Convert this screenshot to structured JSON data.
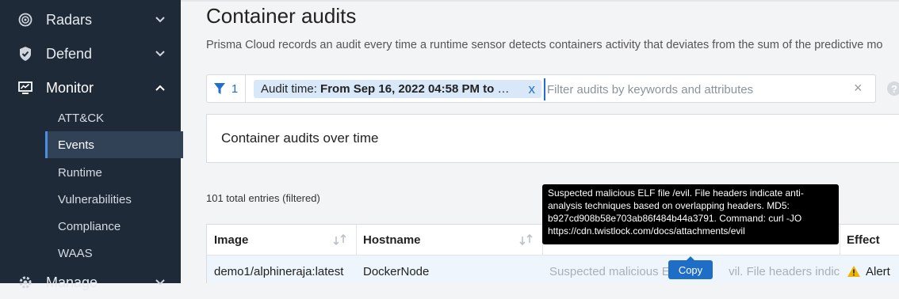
{
  "sidebar": {
    "items": [
      {
        "label": "Radars",
        "icon": "radar-icon",
        "expanded": false
      },
      {
        "label": "Defend",
        "icon": "shield-icon",
        "expanded": false
      },
      {
        "label": "Monitor",
        "icon": "monitor-icon",
        "expanded": true
      },
      {
        "label": "Manage",
        "icon": "gear-icon",
        "expanded": false
      }
    ],
    "sub_items": [
      "ATT&CK",
      "Events",
      "Runtime",
      "Vulnerabilities",
      "Compliance",
      "WAAS"
    ],
    "active_sub": "Events"
  },
  "page": {
    "title": "Container audits",
    "description": "Prisma Cloud records an audit every time a runtime sensor detects containers activity that deviates from the sum of the predictive mo"
  },
  "filter": {
    "count": "1",
    "chip_key": "Audit time:",
    "chip_value": "From Sep 16, 2022 04:58 PM to De...",
    "chip_remove": "x",
    "placeholder": "Filter audits by keywords and attributes",
    "clear": "×",
    "help": "?"
  },
  "chart": {
    "title": "Container audits over time"
  },
  "table": {
    "total": "101 total entries (filtered)",
    "columns": [
      "Image",
      "Hostname",
      "",
      "Effect"
    ],
    "rows": [
      {
        "image": "demo1/alphineraja:latest",
        "hostname": "DockerNode",
        "message_left": "Suspected malicious EL",
        "message_right": "vil. File headers indic...",
        "effect": "Alert"
      }
    ]
  },
  "tooltip": {
    "lines": [
      "Suspected malicious ELF file /evil. File headers indicate anti-",
      "analysis techniques based on overlapping headers. MD5:",
      "b927cd908b58e703ab86f484b44a3791. Command: curl -JO",
      "https://cdn.twistlock.com/docs/attachments/evil"
    ]
  },
  "copy_label": "Copy",
  "colors": {
    "sidebar": "#1e2a38",
    "accent": "#1f6fd1",
    "chip": "#d9e8f8",
    "alert": "#f0b400"
  }
}
